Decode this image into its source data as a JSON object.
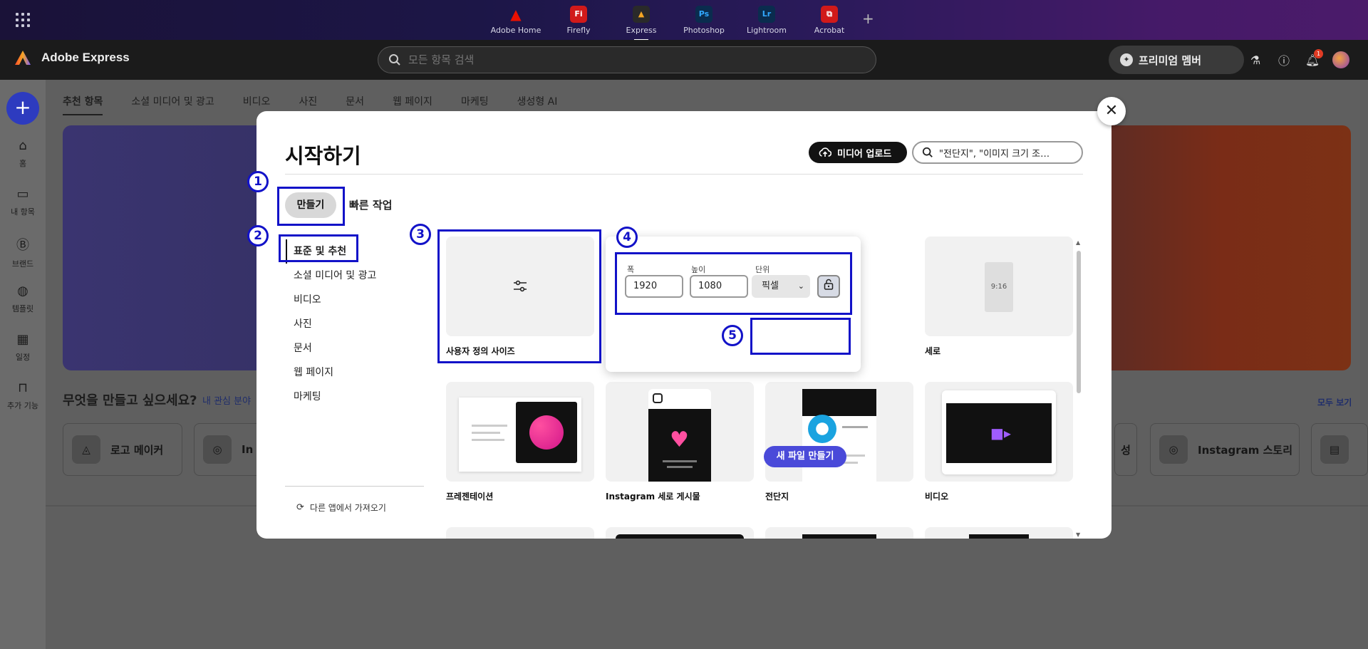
{
  "apps": [
    {
      "label": "Adobe Home",
      "glyph": "▲",
      "color": "#eb1000"
    },
    {
      "label": "Firefly",
      "glyph": "Fi",
      "color": "#d11a1a"
    },
    {
      "label": "Express",
      "glyph": "▲",
      "color": "#2a2a2a"
    },
    {
      "label": "Photoshop",
      "glyph": "Ps",
      "color": "#0a2c4e"
    },
    {
      "label": "Lightroom",
      "glyph": "Lr",
      "color": "#0a2c4e"
    },
    {
      "label": "Acrobat",
      "glyph": "⧉",
      "color": "#d11a1a"
    }
  ],
  "header": {
    "brand": "Adobe Express",
    "search_placeholder": "모든 항목 검색",
    "premium_label": "프리미엄 멤버",
    "notification_count": "1"
  },
  "rail": {
    "items": [
      {
        "label": "홈",
        "icon": "home-icon"
      },
      {
        "label": "내 항목",
        "icon": "folder-icon"
      },
      {
        "label": "브랜드",
        "icon": "brand-icon"
      },
      {
        "label": "템플릿",
        "icon": "template-icon"
      },
      {
        "label": "일정",
        "icon": "calendar-icon"
      },
      {
        "label": "추가 기능",
        "icon": "addons-icon"
      }
    ]
  },
  "page": {
    "tabs": [
      "추천 항목",
      "소셜 미디어 및 광고",
      "비디오",
      "사진",
      "문서",
      "웹 페이지",
      "마케팅",
      "생성형 AI"
    ],
    "heading": "무엇을 만들고 싶으세요?",
    "interest_link": "내 관심 분야",
    "see_all": "모두 보기",
    "cards": [
      "로고 메이커",
      "In",
      "성",
      "Instagram 스토리"
    ]
  },
  "modal": {
    "title": "시작하기",
    "upload_label": "미디어 업로드",
    "search_value": "\"전단지\", \"이미지 크기 조…",
    "tab_create": "만들기",
    "tab_quick": "빠른 작업",
    "categories": [
      "표준 및 추천",
      "소셜 미디어 및 광고",
      "비디오",
      "사진",
      "문서",
      "웹 페이지",
      "마케팅"
    ],
    "import_label": "다른 앱에서 가져오기",
    "tiles": {
      "custom": "사용자 정의 사이즈",
      "portrait": "세로",
      "portrait_ratio": "9:16",
      "presentation": "프레젠테이션",
      "instagram": "Instagram 세로 게시물",
      "flyer": "전단지",
      "video": "비디오"
    },
    "popover": {
      "width_label": "폭",
      "height_label": "높이",
      "unit_label": "단위",
      "width_value": "1920",
      "height_value": "1080",
      "unit_value": "픽셀",
      "create_button": "새 파일 만들기"
    }
  },
  "annotations": [
    "1",
    "2",
    "3",
    "4",
    "5"
  ],
  "colors": {
    "annotation": "#1212c8",
    "accent": "#4a4ad9"
  }
}
